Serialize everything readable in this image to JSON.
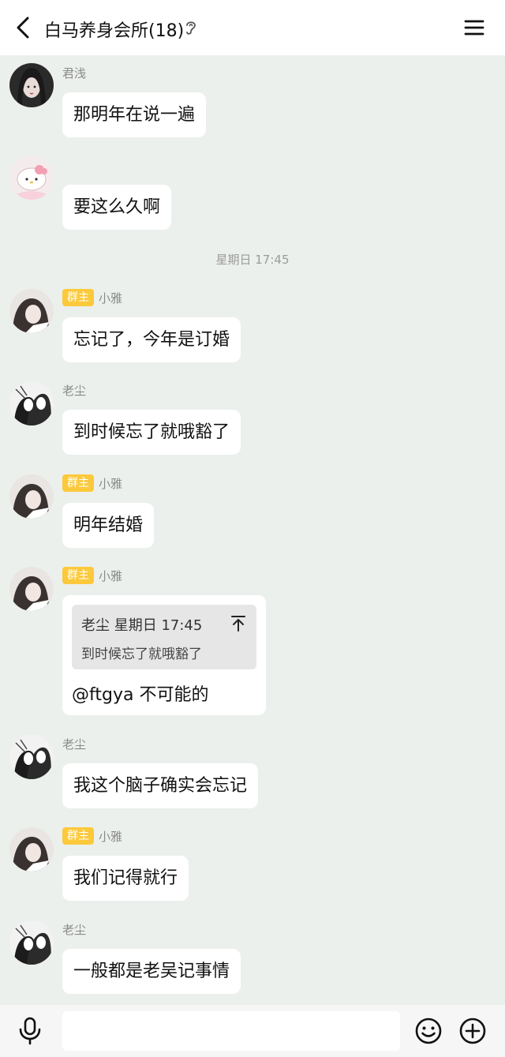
{
  "header": {
    "title": "白马养身会所(18)"
  },
  "messages": {
    "m1": {
      "sender": "君浅",
      "text": "那明年在说一遍"
    },
    "m2": {
      "sender": "",
      "text": "要这么久啊"
    },
    "time1": "星期日 17:45",
    "m3": {
      "badge": "群主",
      "sender": "小雅",
      "text": "忘记了，今年是订婚"
    },
    "m4": {
      "sender": "老尘",
      "text": "到时候忘了就哦豁了"
    },
    "m5": {
      "badge": "群主",
      "sender": "小雅",
      "text": "明年结婚"
    },
    "m6": {
      "badge": "群主",
      "sender": "小雅",
      "quote_header": "老尘 星期日 17:45",
      "quote_text": "到时候忘了就哦豁了",
      "text": "@ftgya 不可能的"
    },
    "m7": {
      "sender": "老尘",
      "text": "我这个脑子确实会忘记"
    },
    "m8": {
      "badge": "群主",
      "sender": "小雅",
      "text": "我们记得就行"
    },
    "m9": {
      "sender": "老尘",
      "text": "一般都是老吴记事情"
    }
  },
  "input": {
    "value": "",
    "placeholder": ""
  },
  "icons": {
    "back": "chevron-left-icon",
    "ear": "ear-icon",
    "menu": "menu-icon",
    "mic": "microphone-icon",
    "emoji": "emoji-icon",
    "plus": "plus-icon"
  },
  "colors": {
    "chat_background": "#ecf0ec",
    "owner_badge": "#fbc93b",
    "bubble": "#ffffff"
  }
}
